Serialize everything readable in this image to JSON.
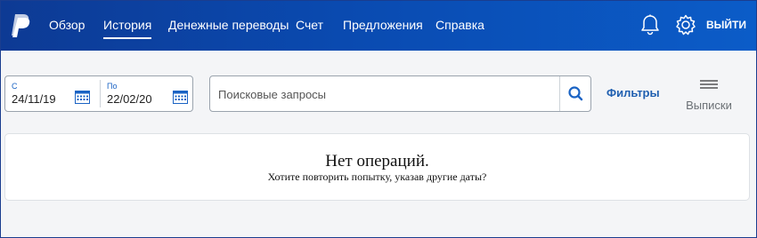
{
  "header": {
    "nav": [
      {
        "label": "Обзор",
        "active": false
      },
      {
        "label": "История",
        "active": true
      },
      {
        "label": "Денежные переводы",
        "active": false
      },
      {
        "label": "Счет",
        "active": false
      },
      {
        "label": "Предложения",
        "active": false
      },
      {
        "label": "Справка",
        "active": false
      }
    ],
    "logout_label": "ВЫЙТИ",
    "icons": {
      "logo": "paypal-logo",
      "notifications": "bell-icon",
      "settings": "gear-icon"
    }
  },
  "date_range": {
    "from": {
      "label": "С",
      "value": "24/11/19"
    },
    "to": {
      "label": "По",
      "value": "22/02/20"
    }
  },
  "search": {
    "placeholder": "Поисковые запросы"
  },
  "filters_label": "Фильтры",
  "statements_label": "Выписки",
  "empty_state": {
    "title": "Нет операций.",
    "subtitle": "Хотите повторить попытку, указав другие даты?"
  },
  "colors": {
    "header_start": "#0d3a94",
    "header_end": "#0b5cc8",
    "link": "#1f5fb0",
    "accent": "#1a63c4"
  }
}
